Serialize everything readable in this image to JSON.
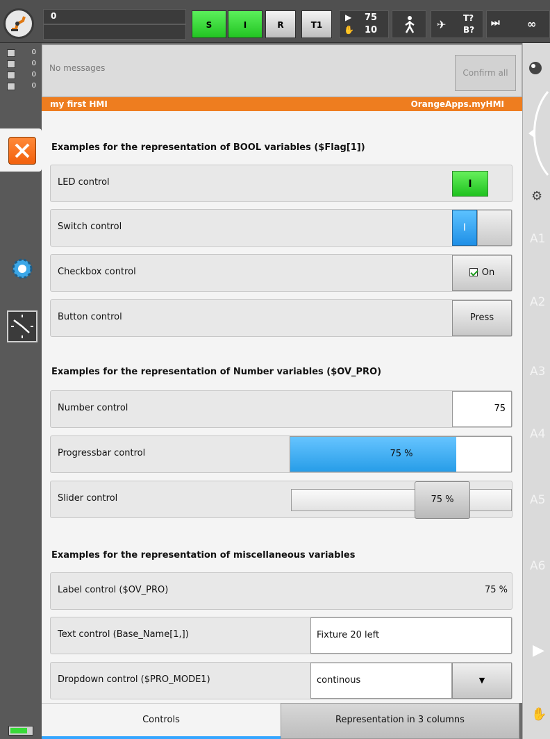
{
  "topbar": {
    "program_line": "0",
    "status_buttons": [
      {
        "label": "S",
        "color": "#2bd62b"
      },
      {
        "label": "I",
        "color": "#2bd62b"
      },
      {
        "label": "R",
        "color": "#dcdcdc"
      },
      {
        "label": "T1",
        "color": "#dcdcdc"
      }
    ],
    "override_top": "75",
    "override_bottom": "10",
    "tool_base_top": "T?",
    "tool_base_bottom": "B?",
    "infinity": "∞"
  },
  "left": {
    "message_counts": [
      "0",
      "0",
      "0",
      "0"
    ]
  },
  "messages": {
    "text": "No messages",
    "confirm_label": "Confirm all"
  },
  "hmi": {
    "title": "my first HMI",
    "app": "OrangeApps.myHMI"
  },
  "bool_section": {
    "title": "Examples for the representation of BOOL variables ($Flag[1])",
    "led_label": "LED control",
    "led_value": "I",
    "switch_label": "Switch control",
    "switch_value": "I",
    "checkbox_label": "Checkbox control",
    "checkbox_value": "On",
    "button_label": "Button control",
    "button_value": "Press"
  },
  "number_section": {
    "title": "Examples for the representation of Number variables ($OV_PRO)",
    "number_label": "Number control",
    "number_value": "75",
    "progress_label": "Progressbar control",
    "progress_text": "75 %",
    "progress_fraction": 0.75,
    "slider_label": "Slider control",
    "slider_text": "75 %",
    "slider_fraction": 0.75
  },
  "misc_section": {
    "title": "Examples for the representation of miscellaneous variables",
    "label_label": "Label control ($OV_PRO)",
    "label_value": "75 %",
    "text_label": "Text control (Base_Name[1,])",
    "text_value": "Fixture 20 left",
    "dropdown_label": "Dropdown control ($PRO_MODE1)",
    "dropdown_value": "continous"
  },
  "tabs": [
    "Controls",
    "Representation in 3 columns"
  ],
  "right_axes": [
    "A1",
    "A2",
    "A3",
    "A4",
    "A5",
    "A6"
  ],
  "colors": {
    "accent_orange": "#ee7d1f",
    "active_blue": "#35a6ff",
    "led_green": "#2bd62b"
  }
}
